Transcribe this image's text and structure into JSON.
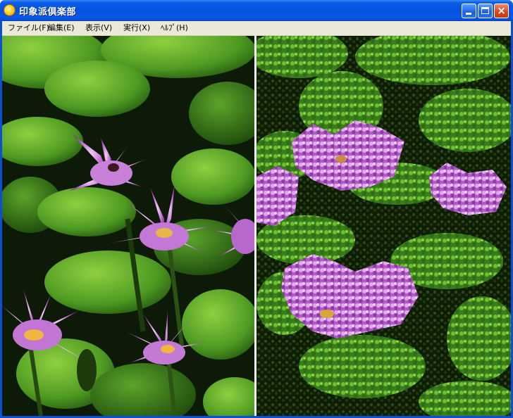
{
  "window": {
    "title": "印象派倶楽部",
    "icon": "sun-icon",
    "buttons": {
      "minimize": "minimize-icon",
      "maximize": "maximize-icon",
      "close": "×"
    }
  },
  "menu": {
    "items": [
      {
        "label": "ファイル(F)"
      },
      {
        "label": "編集(E)"
      },
      {
        "label": "表示(V)"
      },
      {
        "label": "実行(X)"
      },
      {
        "label": "ﾍﾙﾌﾟ(H)"
      }
    ]
  },
  "content": {
    "left_image": "water-lily-photo-original",
    "right_image": "water-lily-impressionist-render",
    "colors": {
      "leaf": "#3f8a1e",
      "leaf_light": "#7fc23a",
      "petal": "#b062c8",
      "petal_light": "#e6b3ef",
      "center": "#f2c23a",
      "water": "#0c1a06"
    }
  }
}
